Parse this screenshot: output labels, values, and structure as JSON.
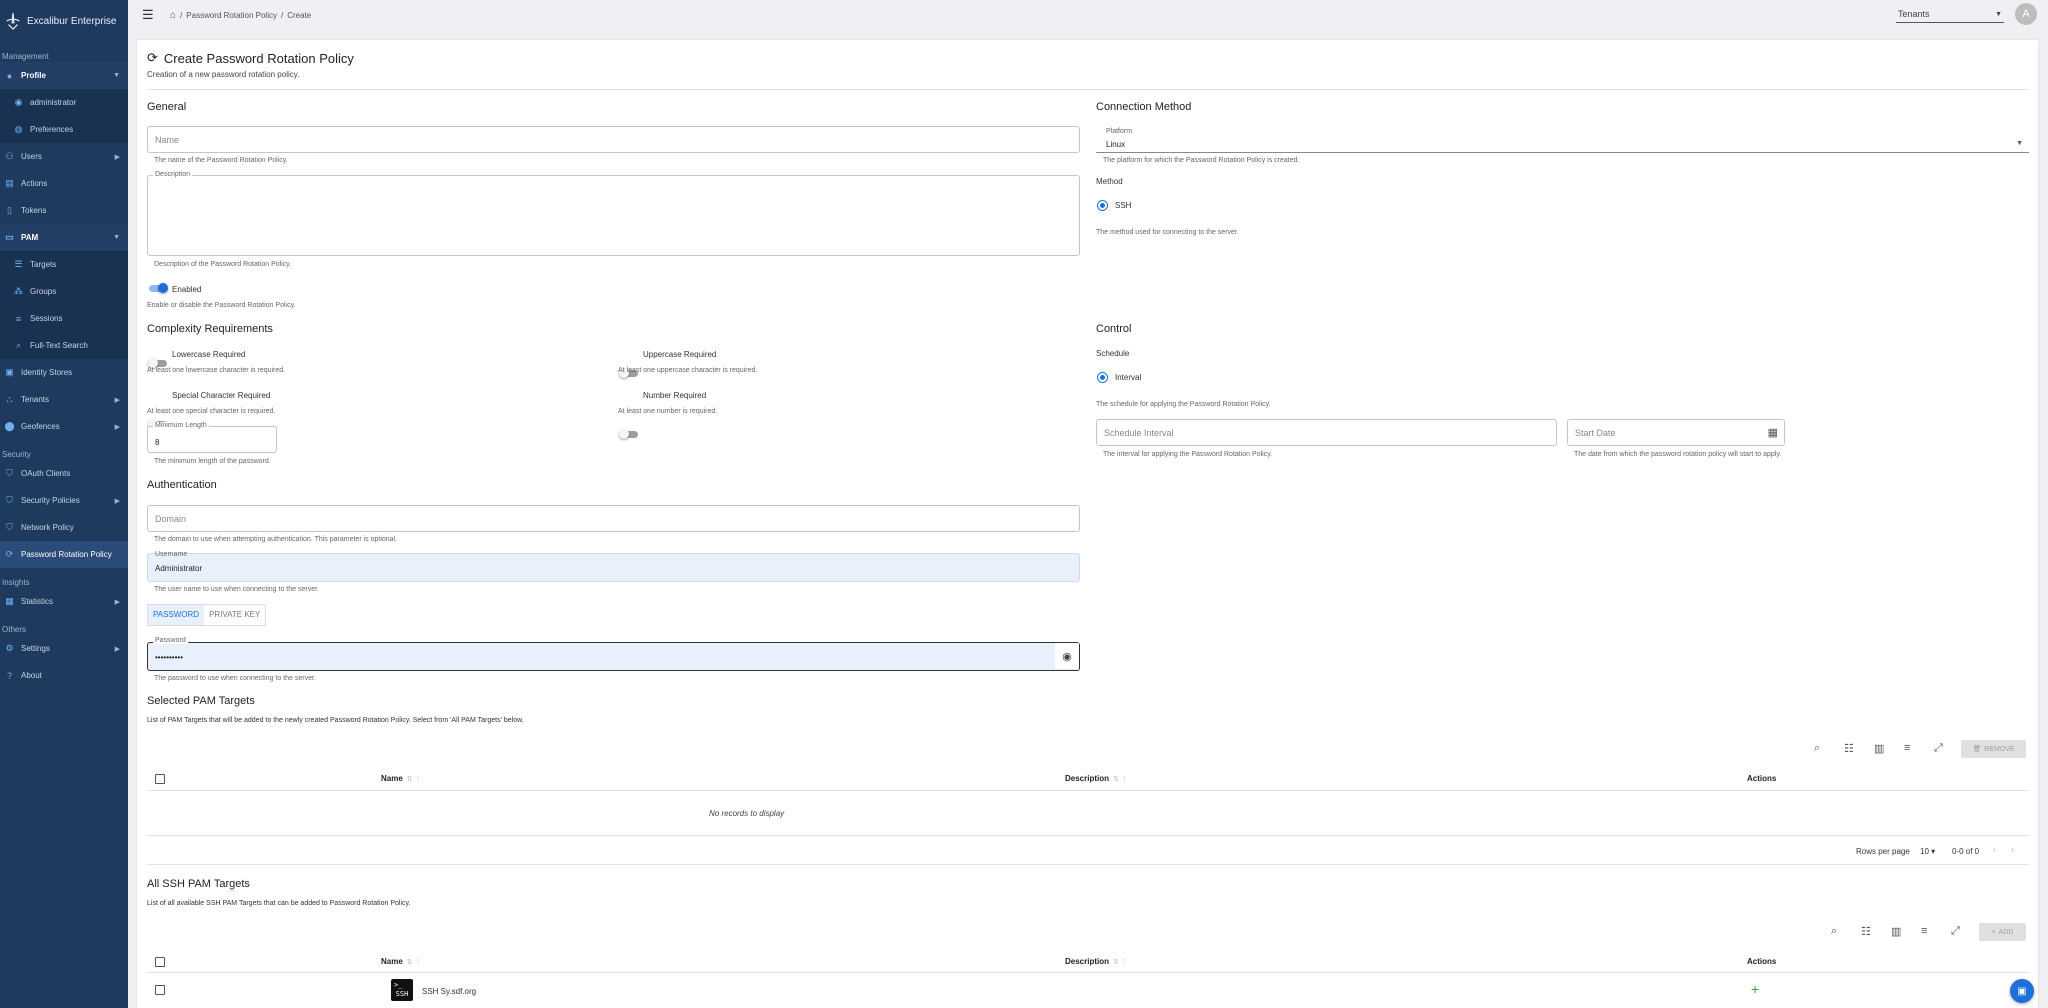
{
  "brand": {
    "name": "Excalibur Enterprise"
  },
  "sidebar": {
    "sections": {
      "management": "Management",
      "security": "Security",
      "insights": "Insights",
      "others": "Others"
    },
    "items": {
      "profile": "Profile",
      "administrator": "administrator",
      "preferences": "Preferences",
      "users": "Users",
      "actions": "Actions",
      "tokens": "Tokens",
      "pam": "PAM",
      "targets": "Targets",
      "groups": "Groups",
      "sessions": "Sessions",
      "full_text_search": "Full-Text Search",
      "identity_stores": "Identity Stores",
      "tenants": "Tenants",
      "geofences": "Geofences",
      "oauth_clients": "OAuth Clients",
      "security_policies": "Security Policies",
      "network_policy": "Network Policy",
      "password_rotation_policy": "Password Rotation Policy",
      "statistics": "Statistics",
      "settings": "Settings",
      "about": "About"
    }
  },
  "topbar": {
    "breadcrumb": [
      "Password Rotation Policy",
      "Create"
    ],
    "tenant_select": "Tenants",
    "avatar_letter": "A"
  },
  "page": {
    "title": "Create Password Rotation Policy",
    "subtitle": "Creation of a new password rotation policy."
  },
  "general": {
    "heading": "General",
    "name_placeholder": "Name",
    "name_helper": "The name of the Password Rotation Policy.",
    "description_label": "Description",
    "description_helper": "Description of the Password Rotation Policy.",
    "enabled_label": "Enabled",
    "enabled_helper": "Enable or disable the Password Rotation Policy."
  },
  "connection": {
    "heading": "Connection Method",
    "platform_label": "Platform",
    "platform_value": "Linux",
    "platform_helper": "The platform for which the Password Rotation Policy is created.",
    "method_label": "Method",
    "method_option": "SSH",
    "method_helper": "The method used for connecting to the server."
  },
  "complexity": {
    "heading": "Complexity Requirements",
    "lowercase_label": "Lowercase Required",
    "lowercase_helper": "At least one lowercase character is required.",
    "uppercase_label": "Uppercase Required",
    "uppercase_helper": "At least one uppercase character is required.",
    "special_label": "Special Character Required",
    "special_helper": "At least one special character is required.",
    "number_label": "Number Required",
    "number_helper": "At least one number is required.",
    "min_length_label": "Minimum Length",
    "min_length_value": "8",
    "min_length_helper": "The minimum length of the password."
  },
  "control": {
    "heading": "Control",
    "schedule_label": "Schedule",
    "schedule_option": "Interval",
    "schedule_helper": "The schedule for applying the Password Rotation Policy.",
    "interval_placeholder": "Schedule Interval",
    "interval_helper": "The interval for applying the Password Rotation Policy.",
    "start_placeholder": "Start Date",
    "start_helper": "The date from which the password rotation policy will start to apply."
  },
  "auth": {
    "heading": "Authentication",
    "domain_placeholder": "Domain",
    "domain_helper": "The domain to use when attempting authentication. This parameter is optional.",
    "username_label": "Username",
    "username_value": "Administrator",
    "username_helper": "The user name to use when connecting to the server.",
    "tab_password": "PASSWORD",
    "tab_private_key": "PRIVATE KEY",
    "password_label": "Password",
    "password_value": "••••••••••",
    "password_helper": "The password to use when connecting to the server."
  },
  "selected_targets": {
    "heading": "Selected PAM Targets",
    "description": "List of PAM Targets that will be added to the newly created Password Rotation Policy. Select from 'All PAM Targets' below.",
    "remove_label": "REMOVE",
    "columns": {
      "name": "Name",
      "description": "Description",
      "actions": "Actions"
    },
    "empty": "No records to display",
    "rows_per_page_label": "Rows per page",
    "rows_per_page": "10",
    "range": "0-0 of 0"
  },
  "all_targets": {
    "heading": "All SSH PAM Targets",
    "description": "List of all available SSH PAM Targets that can be added to Password Rotation Policy.",
    "add_label": "ADD",
    "columns": {
      "name": "Name",
      "description": "Description",
      "actions": "Actions"
    },
    "rows": [
      {
        "logo": "SSH",
        "name": "SSH Sy.sdf.org"
      }
    ]
  },
  "colors": {
    "sidebar": "#1f3a5f",
    "accent": "#1e6fd9",
    "add": "#2e9d4a"
  }
}
